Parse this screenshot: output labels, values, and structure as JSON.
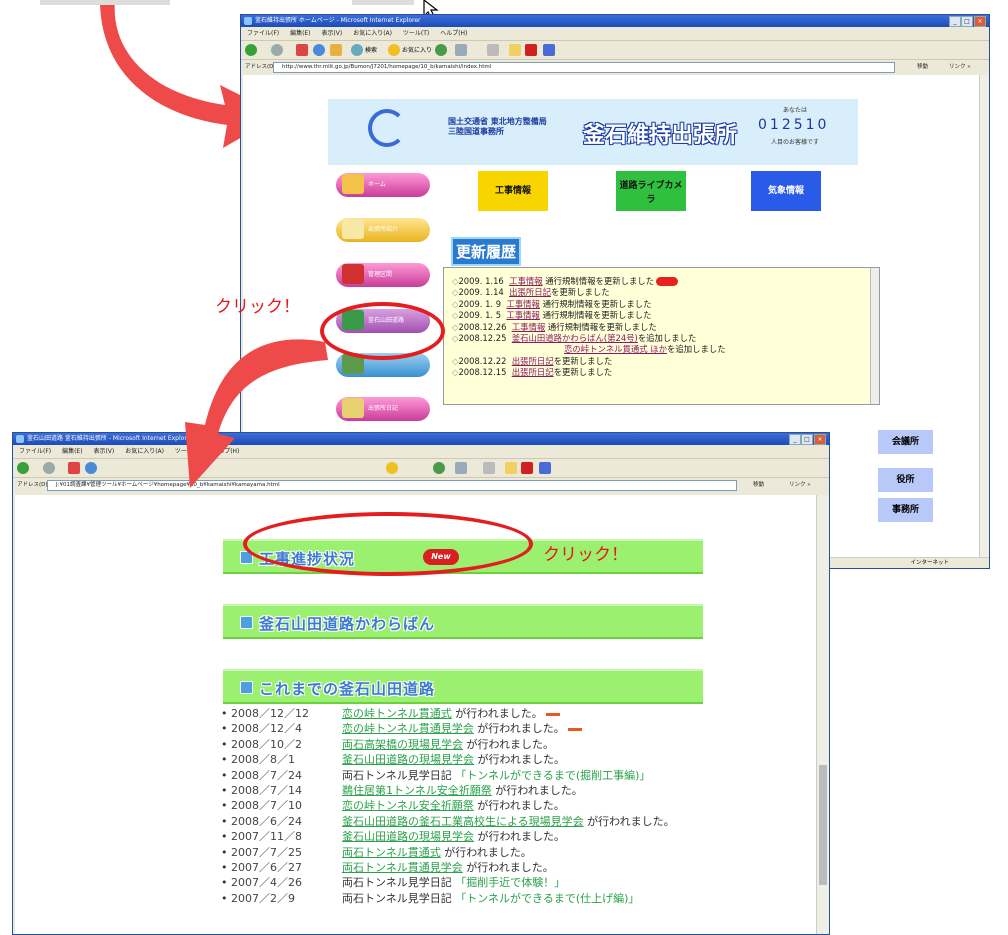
{
  "annotations": {
    "click_label_1": "クリック！",
    "click_label_2": "クリック！"
  },
  "colors": {
    "arrow": "#ef4a4a",
    "annotation_red": "#e41e1e",
    "green_bar": "#9cf070",
    "news_bg": "#ffffd8"
  },
  "icons": [
    "curved-arrow-icon",
    "mouse-cursor-icon",
    "ie-logo-icon",
    "back-icon",
    "forward-icon",
    "search-icon",
    "favorites-icon",
    "new-badge-icon"
  ],
  "top_window": {
    "title": "釜石維持出張所 ホームページ - Microsoft Internet Explorer",
    "menu": [
      "ファイル(F)",
      "編集(E)",
      "表示(V)",
      "お気に入り(A)",
      "ツール(T)",
      "ヘルプ(H)"
    ],
    "toolbar": {
      "back": "戻る",
      "search": "検索",
      "favorites": "お気に入り"
    },
    "address_label": "アドレス(D)",
    "address": "http://www.thr.mlit.go.jp/Bumon/J7201/homepage/10_b/kamaishi/index.html",
    "go": "移動",
    "links": "リンク »",
    "page": {
      "header_org": "国土交通省 東北地方整備局 三陸国道事務所",
      "header_title": "釜石維持出張所",
      "counter_prefix": "あなたは",
      "counter": "012510",
      "counter_suffix": "人目のお客様です",
      "nav": [
        "ホーム",
        "出張所紹介",
        "管理区間",
        "釜石山田道路",
        "",
        "出張所日記"
      ],
      "info_buttons": [
        "工事情報",
        "道路ライブカメラ",
        "気象情報"
      ],
      "update_heading": "更新履歴",
      "news": [
        {
          "date": "2009. 1.16",
          "link": "工事情報",
          "text": "通行規制情報を更新しました"
        },
        {
          "date": "2009. 1.14",
          "link": "出張所日記",
          "text": "を更新しました"
        },
        {
          "date": "2009. 1. 9",
          "link": "工事情報",
          "text": "通行規制情報を更新しました"
        },
        {
          "date": "2009. 1. 5",
          "link": "工事情報",
          "text": "通行規制情報を更新しました"
        },
        {
          "date": "2008.12.26",
          "link": "工事情報",
          "text": "通行規制情報を更新しました"
        },
        {
          "date": "2008.12.25",
          "link": "釜石山田道路かわらばん(第24号)",
          "text": "を追加しました"
        },
        {
          "date": "",
          "link": "恋の峠トンネル貫通式 ほか",
          "text": "を追加しました"
        },
        {
          "date": "2008.12.22",
          "link": "出張所日記",
          "text": "を更新しました"
        },
        {
          "date": "2008.12.15",
          "link": "出張所日記",
          "text": "を更新しました"
        }
      ],
      "right_side": [
        "会議所",
        "役所",
        "事務所"
      ]
    },
    "status": "インターネット"
  },
  "bottom_window": {
    "title": "釜石山田道路 釜石維持出張所 - Microsoft Internet Explorer",
    "menu": [
      "ファイル(F)",
      "編集(E)",
      "表示(V)",
      "お気に入り(A)",
      "ツール(T)",
      "ヘルプ(H)"
    ],
    "address_label": "アドレス(D)",
    "address": "J:¥01調査課¥管理ツール¥ホームページ¥homepage¥10_b¥kamaishi¥kamayama.html",
    "go": "移動",
    "links": "リンク »",
    "page": {
      "bars": [
        "工事進捗状況",
        "釜石山田道路かわらばん",
        "これまでの釜石山田道路"
      ],
      "new_badge": "New",
      "history": [
        {
          "date": "2008／12／12",
          "link": "恋の峠トンネル貫通式",
          "text": "が行われました。"
        },
        {
          "date": "2008／12／4",
          "link": "恋の峠トンネル貫通見学会",
          "text": "が行われました。"
        },
        {
          "date": "2008／10／2",
          "link": "両石高架橋の現場見学会",
          "text": "が行われました。"
        },
        {
          "date": "2008／8／1",
          "link": "釜石山田道路の現場見学会",
          "text": "が行われました。"
        },
        {
          "date": "2008／7／24",
          "link": "両石トンネル見学日記",
          "text": "「トンネルができるまで(掘削工事編)」"
        },
        {
          "date": "2008／7／14",
          "link": "鵜住居第1トンネル安全祈願祭",
          "text": "が行われました。"
        },
        {
          "date": "2008／7／10",
          "link": "恋の峠トンネル安全祈願祭",
          "text": "が行われました。"
        },
        {
          "date": "2008／6／24",
          "link": "釜石山田道路の釜石工業高校生による現場見学会",
          "text": "が行われました。"
        },
        {
          "date": "2007／11／8",
          "link": "釜石山田道路の現場見学会",
          "text": "が行われました。"
        },
        {
          "date": "2007／7／25",
          "link": "両石トンネル貫通式",
          "text": "が行われました。"
        },
        {
          "date": "2007／6／27",
          "link": "両石トンネル貫通見学会",
          "text": "が行われました。"
        },
        {
          "date": "2007／4／26",
          "link": "両石トンネル見学日記",
          "text": "「掘削手近で体験！」"
        },
        {
          "date": "2007／2／9",
          "link": "両石トンネル見学日記",
          "text": "「トンネルができるまで(仕上げ編)」"
        }
      ]
    }
  }
}
